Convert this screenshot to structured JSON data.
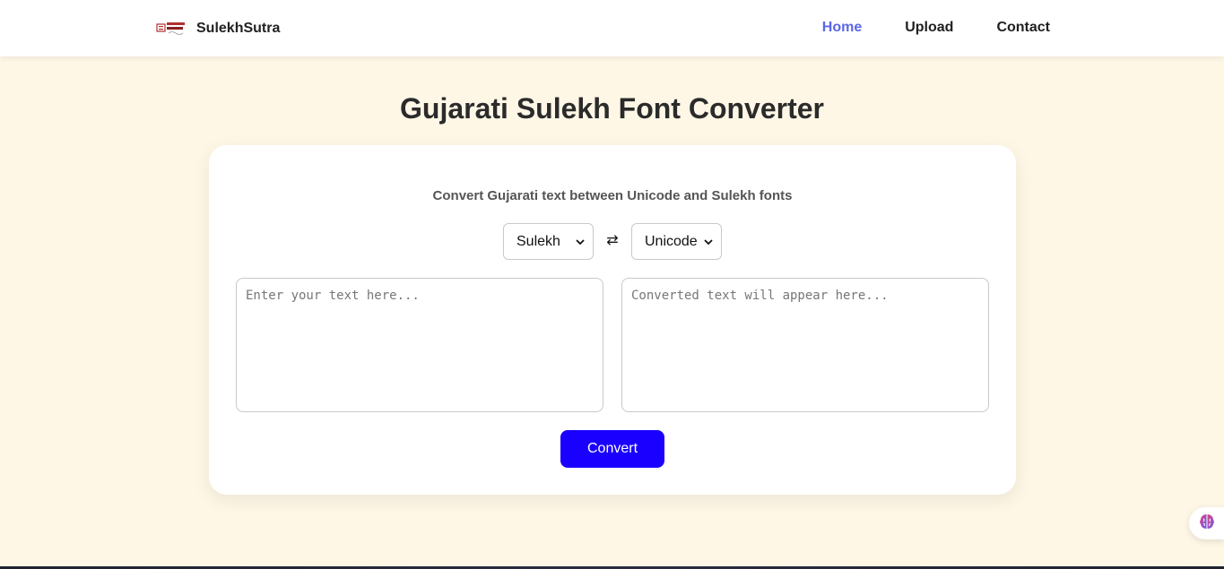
{
  "brand": {
    "logo_text": "SULEKH SUTRA",
    "name": "SulekhSutra"
  },
  "nav": {
    "items": [
      {
        "label": "Home",
        "active": true
      },
      {
        "label": "Upload",
        "active": false
      },
      {
        "label": "Contact",
        "active": false
      }
    ]
  },
  "page": {
    "title": "Gujarati Sulekh Font Converter"
  },
  "converter": {
    "subtitle": "Convert Gujarati text between Unicode and Sulekh fonts",
    "from_font": "Sulekh",
    "to_font": "Unicode",
    "swap_icon": "⇄",
    "input": {
      "value": "",
      "placeholder": "Enter your text here..."
    },
    "output": {
      "value": "",
      "placeholder": "Converted text will appear here..."
    },
    "convert_label": "Convert"
  },
  "colors": {
    "background": "#fff7e6",
    "nav_active": "#5b67e6",
    "button": "#1a00ff"
  },
  "icons": {
    "floating": "brain-icon",
    "select_caret": "chevron-down-icon",
    "swap": "swap-arrows-icon"
  }
}
